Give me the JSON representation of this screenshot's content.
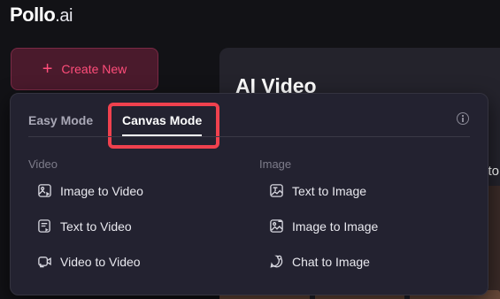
{
  "logo": {
    "brand": "Pollo",
    "suffix": ".ai"
  },
  "create_button": {
    "label": "Create New"
  },
  "background_card": {
    "title": "AI Video",
    "fragment": "to"
  },
  "popover": {
    "tabs": [
      {
        "label": "Easy Mode",
        "active": false
      },
      {
        "label": "Canvas Mode",
        "active": true
      }
    ],
    "sections": [
      {
        "label": "Video",
        "items": [
          {
            "label": "Image to Video",
            "icon": "image-to-video-icon"
          },
          {
            "label": "Text to Video",
            "icon": "text-to-video-icon"
          },
          {
            "label": "Video to Video",
            "icon": "video-to-video-icon"
          }
        ]
      },
      {
        "label": "Image",
        "items": [
          {
            "label": "Text to Image",
            "icon": "text-to-image-icon"
          },
          {
            "label": "Image to Image",
            "icon": "image-to-image-icon"
          },
          {
            "label": "Chat to Image",
            "icon": "chat-to-image-icon"
          }
        ]
      }
    ]
  },
  "colors": {
    "accent": "#ff4d7a",
    "highlight": "#f0414e",
    "background": "#121216",
    "popover": "#232230"
  }
}
